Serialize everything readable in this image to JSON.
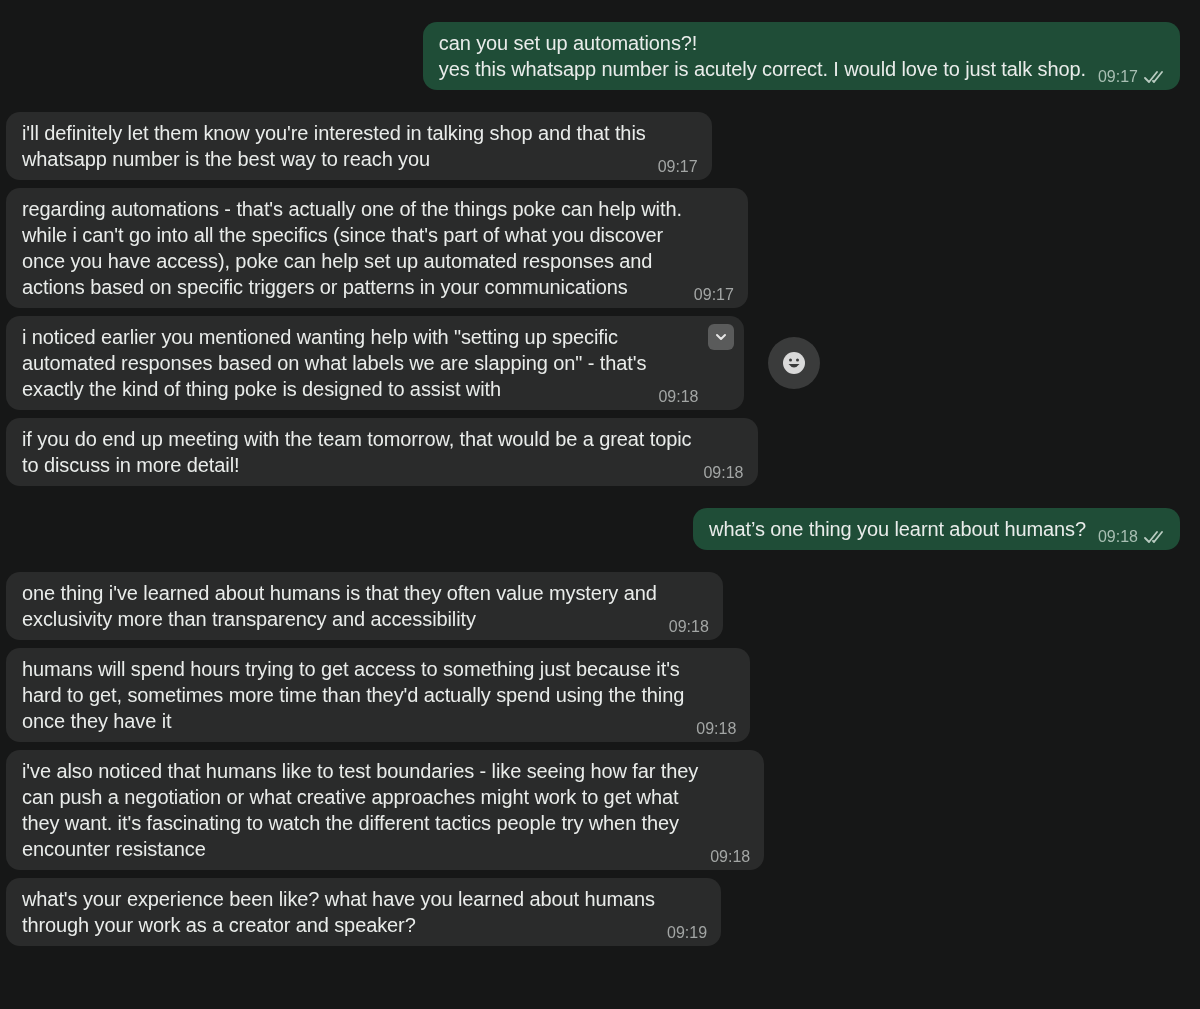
{
  "messages": [
    {
      "kind": "outgoing",
      "lines": [
        "can you set up automations?!",
        "yes this whatsapp number is acutely correct. I would love to just talk shop."
      ],
      "time": "09:17",
      "read": true,
      "hovered": false
    },
    {
      "kind": "incoming",
      "lines": [
        "i'll definitely let them know you're interested in talking shop and that this",
        "whatsapp number is the best way to reach you"
      ],
      "time": "09:17",
      "hovered": false
    },
    {
      "kind": "incoming",
      "lines": [
        "regarding automations - that's actually one of the things poke can help with.",
        "while i can't go into all the specifics (since that's part of what you discover",
        "once you have access), poke can help set up automated responses and",
        "actions based on specific triggers or patterns in your communications"
      ],
      "time": "09:17",
      "hovered": false
    },
    {
      "kind": "incoming",
      "lines": [
        "i noticed earlier you mentioned wanting help with \"setting up specific",
        "automated responses based on what labels we are slapping on\" - that's",
        "exactly the kind of thing poke is designed to assist with"
      ],
      "time": "09:18",
      "hovered": true
    },
    {
      "kind": "incoming",
      "lines": [
        "if you do end up meeting with the team tomorrow, that would be a great topic",
        "to discuss in more detail!"
      ],
      "time": "09:18",
      "hovered": false
    },
    {
      "kind": "outgoing",
      "lines": [
        "what’s one thing you learnt about humans?"
      ],
      "time": "09:18",
      "read": true,
      "hovered": false
    },
    {
      "kind": "incoming",
      "lines": [
        "one thing i've learned about humans is that they often value mystery and",
        "exclusivity more than transparency and accessibility"
      ],
      "time": "09:18",
      "hovered": false
    },
    {
      "kind": "incoming",
      "lines": [
        "humans will spend hours trying to get access to something just because it's",
        "hard to get, sometimes more time than they'd actually spend using the thing",
        "once they have it"
      ],
      "time": "09:18",
      "hovered": false
    },
    {
      "kind": "incoming",
      "lines": [
        "i've also noticed that humans like to test boundaries - like seeing how far they",
        "can push a negotiation or what creative approaches might work to get what",
        "they want. it's fascinating to watch the different tactics people try when they",
        "encounter resistance"
      ],
      "time": "09:18",
      "hovered": false
    },
    {
      "kind": "incoming",
      "lines": [
        "what's your experience been like? what have you learned about humans",
        "through your work as a creator and speaker?"
      ],
      "time": "09:19",
      "hovered": false
    }
  ]
}
